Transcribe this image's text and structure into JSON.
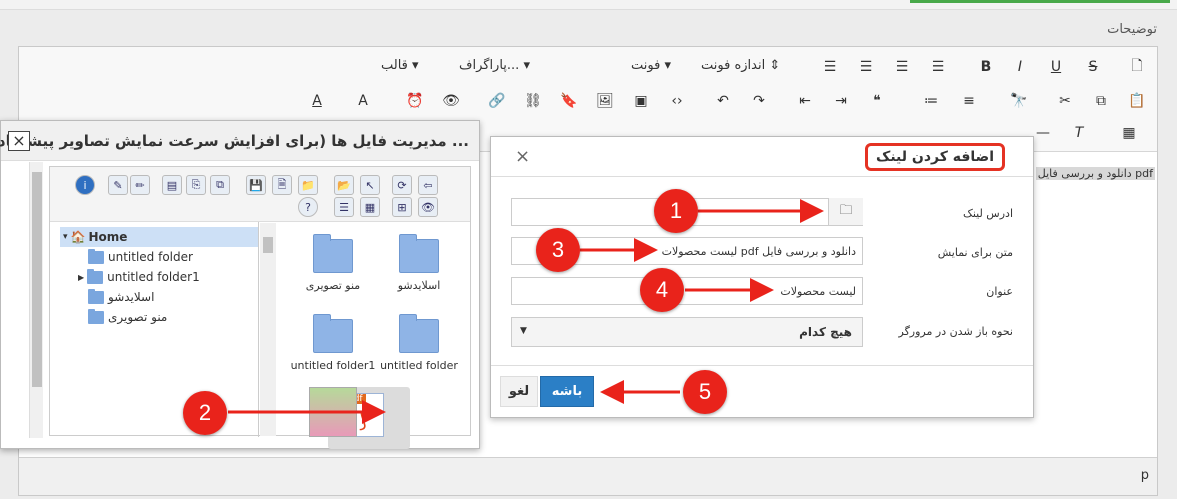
{
  "editor": {
    "field_label": "توضیحات",
    "content_snippet": "دانلود و بررسی فایل pdf",
    "status_path": "p",
    "toolbar": {
      "style_dropdown": "قالب",
      "paragraph_dropdown": "پاراگراف...",
      "font_dropdown": "فونت",
      "fontsize_dropdown": "اندازه فونت",
      "colors": {
        "accent": "#2b7fc6",
        "annotation": "#e9231b"
      }
    }
  },
  "file_manager": {
    "title": "مدیریت فایل ها (برای افزایش سرعت نمایش تصاویر پیشنهاد ...",
    "close_label": "×",
    "tree": [
      {
        "label": "Home",
        "level": 0
      },
      {
        "label": "untitled folder",
        "level": 1
      },
      {
        "label": "untitled folder1",
        "level": 1
      },
      {
        "label": "اسلایدشو",
        "level": 1
      },
      {
        "label": "منو تصویری",
        "level": 1
      }
    ],
    "files": [
      {
        "label": "اسلایدشو",
        "kind": "folder"
      },
      {
        "label": "منو تصویری",
        "kind": "folder"
      },
      {
        "label": "untitled folder",
        "kind": "folder"
      },
      {
        "label": "untitled folder1",
        "kind": "folder"
      },
      {
        "label": "pdf",
        "kind": "pdf"
      },
      {
        "label": "",
        "kind": "image"
      }
    ]
  },
  "link_dialog": {
    "title": "اضافه کردن لینک",
    "close_label": "×",
    "url_label": "ادرس لینک",
    "url_value": "",
    "text_label": "متن برای نمایش",
    "text_value": "دانلود و بررسی فایل pdf لیست محصولات",
    "title_label": "عنوان",
    "title_value": "لیست محصولات",
    "target_label": "نحوه باز شدن در مرورگر",
    "target_value": "هیچ کدام",
    "ok_label": "باشه",
    "cancel_label": "لغو"
  },
  "annotations": [
    "1",
    "2",
    "3",
    "4",
    "5"
  ]
}
